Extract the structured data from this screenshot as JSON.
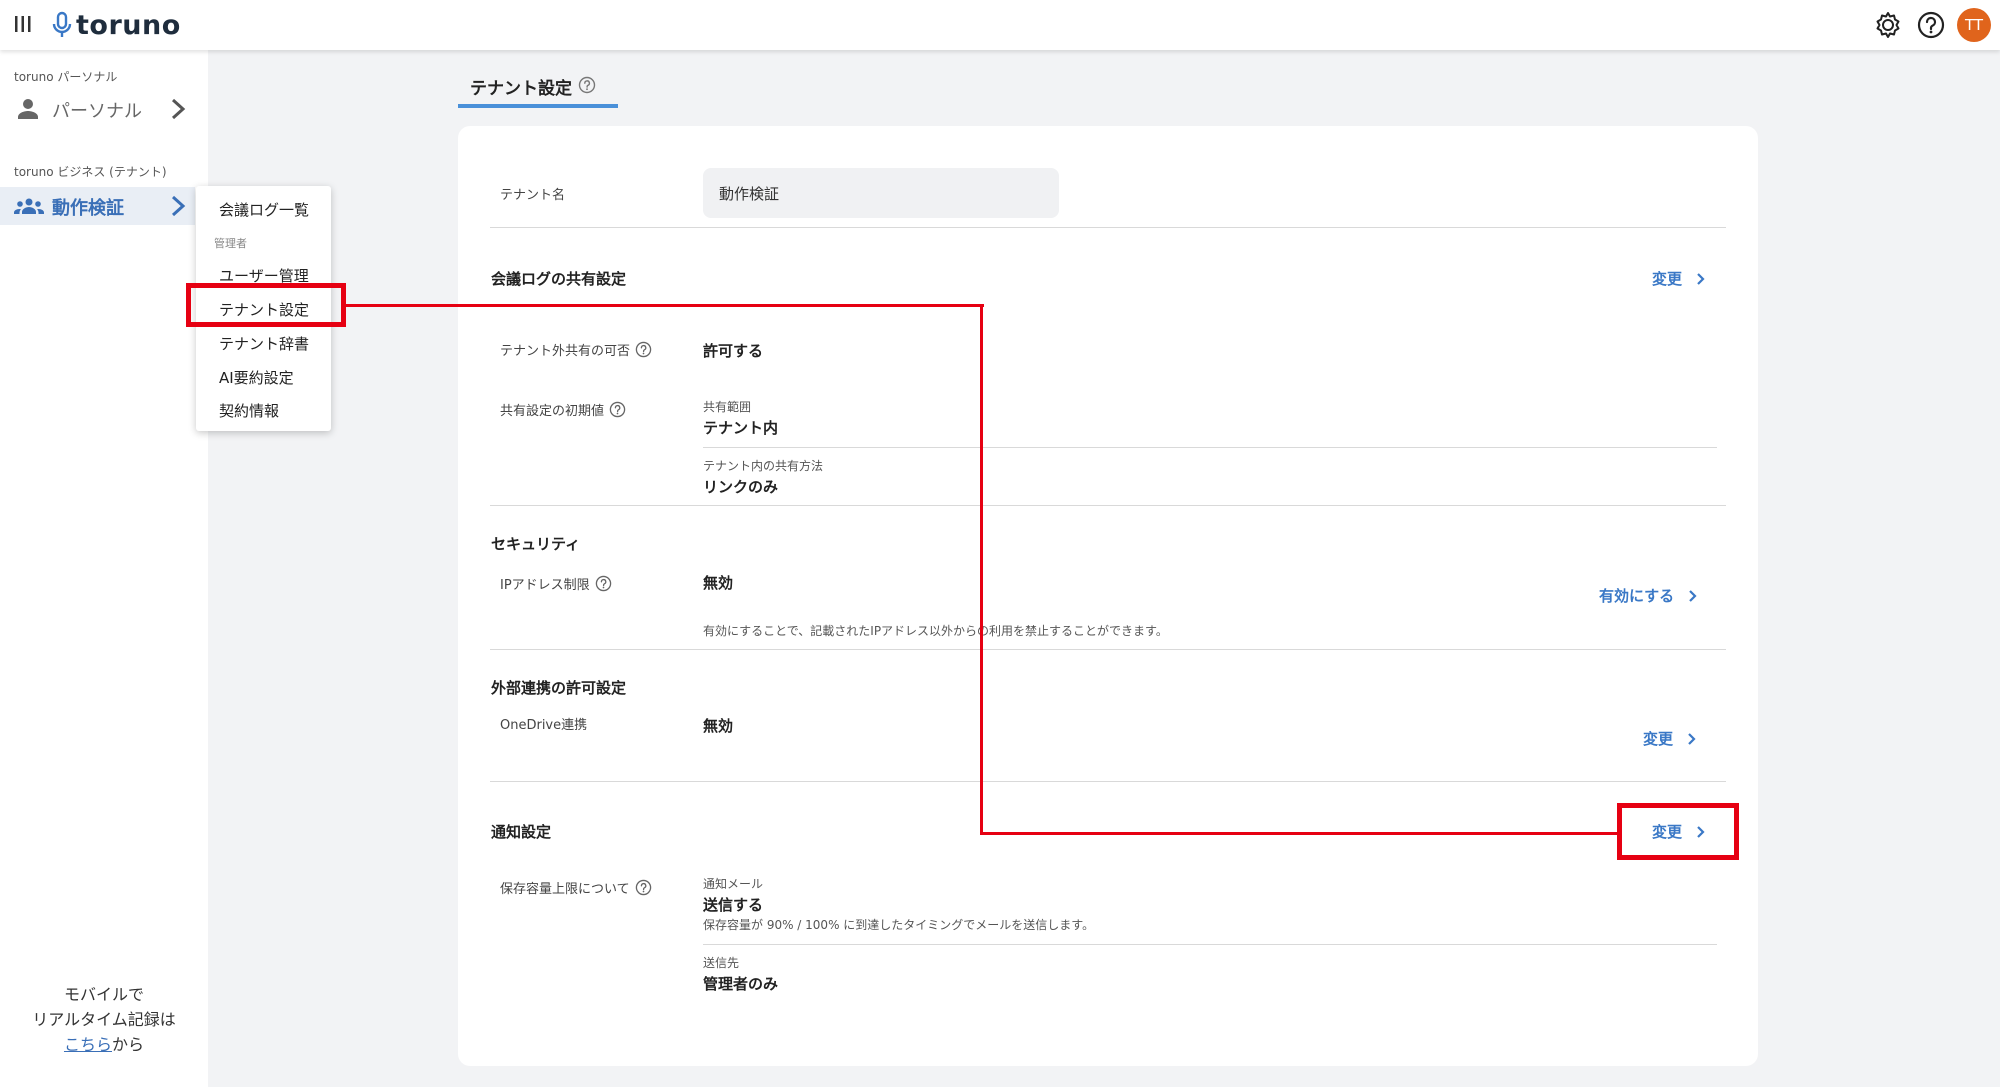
{
  "app": {
    "logo_text": "toruno",
    "avatar_initials": "TT"
  },
  "header": {
    "menu_icon": "menu-icon",
    "settings_icon": "gear-icon",
    "help_icon": "help-icon"
  },
  "sidebar": {
    "personal_section_label": "toruno パーソナル",
    "personal_item": "パーソナル",
    "business_section_label": "toruno ビジネス (テナント)",
    "business_item": "動作検証",
    "mobile_note_line1": "モバイルで",
    "mobile_note_line2": "リアルタイム記録は",
    "mobile_note_link": "こちら",
    "mobile_note_suffix": "から"
  },
  "dropdown": {
    "item_meeting_logs": "会議ログ一覧",
    "admin_label": "管理者",
    "items": [
      "ユーザー管理",
      "テナント設定",
      "テナント辞書",
      "AI要約設定",
      "契約情報"
    ]
  },
  "tab": {
    "title": "テナント設定"
  },
  "card": {
    "tenant_name_label": "テナント名",
    "tenant_name_value": "動作検証",
    "share": {
      "title": "会議ログの共有設定",
      "change": "変更",
      "external_label": "テナント外共有の可否",
      "external_value": "許可する",
      "default_label": "共有設定の初期値",
      "scope_label": "共有範囲",
      "scope_value": "テナント内",
      "method_label": "テナント内の共有方法",
      "method_value": "リンクのみ"
    },
    "security": {
      "title": "セキュリティ",
      "ip_label": "IPアドレス制限",
      "ip_value": "無効",
      "enable_link": "有効にする",
      "note": "有効にすることで、記載されたIPアドレス以外からの利用を禁止することができます。"
    },
    "external": {
      "title": "外部連携の許可設定",
      "onedrive_label": "OneDrive連携",
      "onedrive_value": "無効",
      "change": "変更"
    },
    "notification": {
      "title": "通知設定",
      "change": "変更",
      "storage_label": "保存容量上限について",
      "mail_label": "通知メール",
      "mail_value": "送信する",
      "mail_note": "保存容量が 90% / 100% に到達したタイミングでメールを送信します。",
      "dest_label": "送信先",
      "dest_value": "管理者のみ"
    }
  },
  "colors": {
    "accent": "#3a78c6",
    "annotation": "#e60012",
    "avatar": "#e0641c"
  }
}
